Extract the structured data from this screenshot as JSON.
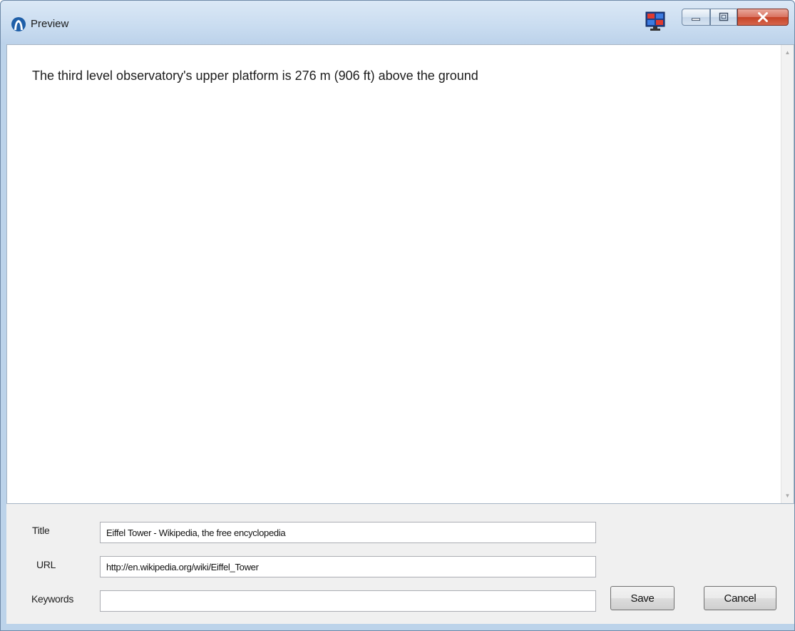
{
  "window": {
    "title": "Preview",
    "icons": {
      "app": "app-logo-icon",
      "tile": "tile-windows-icon",
      "minimize": "minimize-icon",
      "maximize": "maximize-icon",
      "close": "close-icon"
    },
    "accent_colors": {
      "titlebar": "#c9dcf0",
      "close_button": "#c54327"
    }
  },
  "preview": {
    "text": "The third level observatory's upper platform is 276 m (906 ft) above the ground"
  },
  "form": {
    "title_label": "Title",
    "title_value": "Eiffel Tower - Wikipedia, the free encyclopedia",
    "url_label": "URL",
    "url_value": "http://en.wikipedia.org/wiki/Eiffel_Tower",
    "keywords_label": "Keywords",
    "keywords_value": "",
    "save_label": "Save",
    "cancel_label": "Cancel"
  }
}
